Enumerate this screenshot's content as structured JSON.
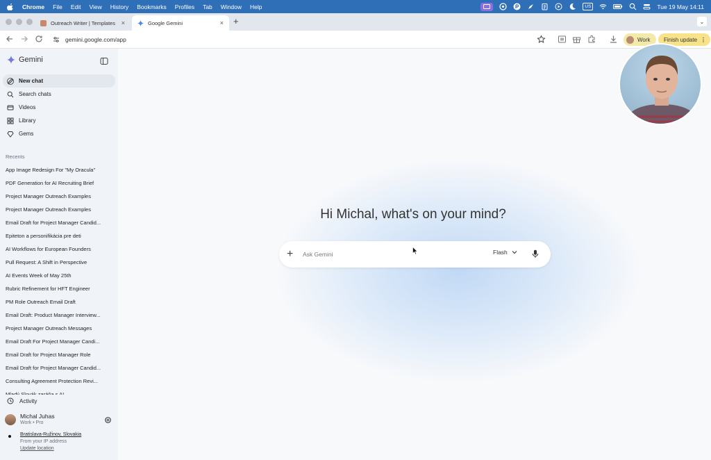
{
  "menubar": {
    "app": "Chrome",
    "items": [
      "File",
      "Edit",
      "View",
      "History",
      "Bookmarks",
      "Profiles",
      "Tab",
      "Window",
      "Help"
    ],
    "input_source": "US",
    "clock": "Tue 19 May  14:11"
  },
  "tabs": [
    {
      "title": "Outreach Writer | Templates",
      "active": false
    },
    {
      "title": "Google Gemini",
      "active": true
    }
  ],
  "toolbar": {
    "url": "gemini.google.com/app",
    "profile_label": "Work",
    "update_label": "Finish update"
  },
  "sidebar": {
    "brand": "Gemini",
    "nav": [
      {
        "label": "New chat",
        "icon": "edit-icon"
      },
      {
        "label": "Search chats",
        "icon": "search-icon"
      },
      {
        "label": "Videos",
        "icon": "video-icon"
      },
      {
        "label": "Library",
        "icon": "library-icon"
      },
      {
        "label": "Gems",
        "icon": "gem-icon"
      }
    ],
    "recents_label": "Recents",
    "recents": [
      "App Image Redesign For \"My Oracula\"",
      "PDF Generation for AI Recruiting Brief",
      "Project Manager Outreach Examples",
      "Project Manager Outreach Examples",
      "Email Draft for Project Manager Candid...",
      "Epiteton a personifikácia pre deti",
      "AI Workflows for European Founders",
      "Pull Request: A Shift in Perspective",
      "AI Events Week of May 25th",
      "Rubric Refinement for HFT Engineer",
      "PM Role Outreach Email Draft",
      "Email Draft: Product Manager Interview...",
      "Project Manager Outreach Messages",
      "Email Draft For Project Manager Candi...",
      "Email Draft for Project Manager Role",
      "Email Draft for Project Manager Candid...",
      "Consulting Agreement Protection Revi...",
      "Mladý Slovák zaráňa s AI"
    ],
    "activity": "Activity",
    "user": {
      "name": "Michal Juhas",
      "plan": "Work • Pro"
    },
    "location": {
      "city": "Bratislava-Ružinov, Slovakia",
      "source": "From your IP address",
      "update": "Update location"
    }
  },
  "main": {
    "greeting": "Hi Michal, what's on your mind?",
    "prompt_placeholder": "Ask Gemini",
    "model": "Flash"
  },
  "colors": {
    "menubar": "#2f6fb8",
    "sidebar_bg": "#f0f4f9",
    "update_pill": "#f8e28a",
    "gemini_blue": "#4a86e8"
  }
}
